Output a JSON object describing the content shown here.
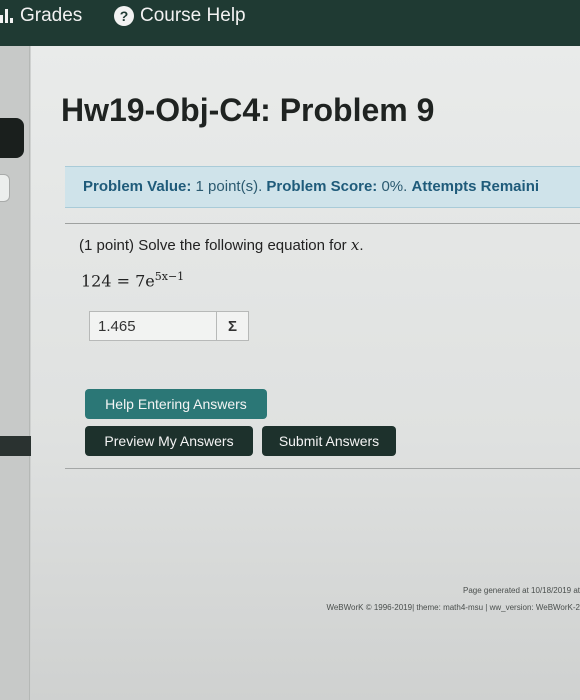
{
  "topbar": {
    "grades_label": "Grades",
    "help_icon_glyph": "?",
    "course_help_label": "Course Help"
  },
  "problem": {
    "title": "Hw19-Obj-C4: Problem 9",
    "value_label": "Problem Value:",
    "value_text": "1 point(s).",
    "score_label": "Problem Score:",
    "score_text": "0%.",
    "attempts_label": "Attempts Remaini",
    "prompt_prefix": "(1 point) Solve the following equation for ",
    "prompt_var": "x",
    "prompt_suffix": ".",
    "equation_lhs": "124 = 7e",
    "equation_exponent": "5x−1",
    "answer_value": "1.465",
    "sigma_glyph": "Σ"
  },
  "buttons": {
    "help_entering": "Help Entering Answers",
    "preview": "Preview My Answers",
    "submit": "Submit Answers"
  },
  "footer": {
    "generated": "Page generated at 10/18/2019 at",
    "copyright": "WeBWorK © 1996-2019| theme: math4-msu | ww_version: WeBWorK-2"
  },
  "colors": {
    "topbar": "#1f3a33",
    "button_help": "#2b7776",
    "button_dark": "#1d312c",
    "score_box": "#cfe3ea",
    "score_text": "#1f5b7a"
  }
}
